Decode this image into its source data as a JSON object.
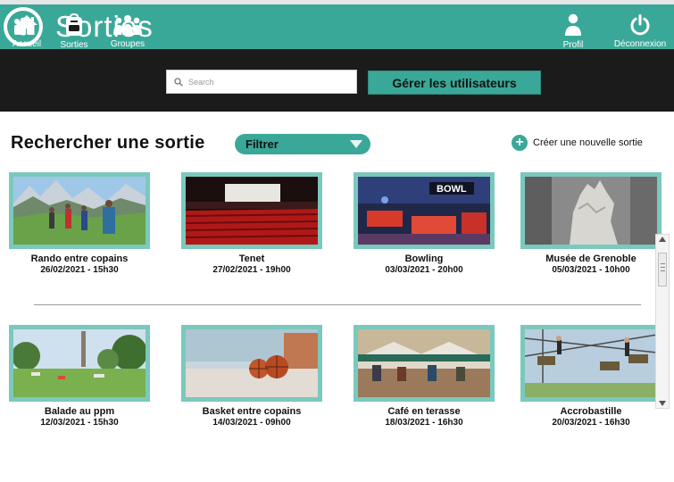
{
  "header": {
    "title": "Sorties"
  },
  "nav": {
    "home": "Accueil",
    "outings": "Sorties",
    "groups": "Groupes",
    "profile": "Profil",
    "logout": "Déconnexion"
  },
  "search": {
    "placeholder": "Search"
  },
  "manage_users_label": "Gérer les utilisateurs",
  "main": {
    "title": "Rechercher une sortie",
    "filter_label": "Filtrer",
    "create_label": "Créer une nouvelle sortie"
  },
  "cards": [
    {
      "title": "Rando entre copains",
      "date": "26/02/2021 - 15h30"
    },
    {
      "title": "Tenet",
      "date": "27/02/2021 - 19h00"
    },
    {
      "title": "Bowling",
      "date": "03/03/2021 - 20h00"
    },
    {
      "title": "Musée de Grenoble",
      "date": "05/03/2021 - 10h00"
    },
    {
      "title": "Balade au ppm",
      "date": "12/03/2021 - 15h30"
    },
    {
      "title": "Basket entre copains",
      "date": "14/03/2021 - 09h00"
    },
    {
      "title": "Café en terasse",
      "date": "18/03/2021 - 16h30"
    },
    {
      "title": "Accrobastille",
      "date": "20/03/2021 - 16h30"
    }
  ],
  "bowling_sign": "BOWL",
  "colors": {
    "accent": "#3aa898",
    "navbar": "#1c1b1b",
    "card_border": "#7bc8bd"
  }
}
